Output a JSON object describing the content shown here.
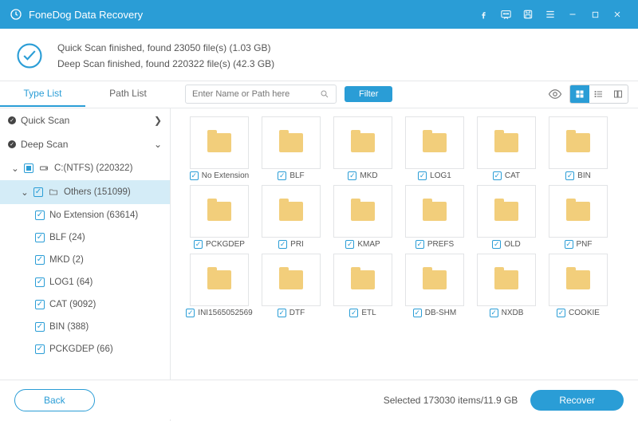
{
  "titlebar": {
    "app_name": "FoneDog Data Recovery"
  },
  "summary": {
    "quick_line": "Quick Scan finished, found 23050 file(s) (1.03 GB)",
    "deep_line": "Deep Scan finished, found 220322 file(s) (42.3 GB)"
  },
  "tabs": {
    "type": "Type List",
    "path": "Path List"
  },
  "search": {
    "placeholder": "Enter Name or Path here"
  },
  "filter_label": "Filter",
  "sidebar": {
    "quick_scan": "Quick Scan",
    "deep_scan": "Deep Scan",
    "drive": "C:(NTFS) (220322)",
    "others": "Others (151099)",
    "items": [
      {
        "label": "No Extension (63614)"
      },
      {
        "label": "BLF (24)"
      },
      {
        "label": "MKD (2)"
      },
      {
        "label": "LOG1 (64)"
      },
      {
        "label": "CAT (9092)"
      },
      {
        "label": "BIN (388)"
      },
      {
        "label": "PCKGDEP (66)"
      }
    ]
  },
  "grid": [
    [
      {
        "label": "No Extension"
      },
      {
        "label": "BLF"
      },
      {
        "label": "MKD"
      },
      {
        "label": "LOG1"
      },
      {
        "label": "CAT"
      },
      {
        "label": "BIN"
      }
    ],
    [
      {
        "label": "PCKGDEP"
      },
      {
        "label": "PRI"
      },
      {
        "label": "KMAP"
      },
      {
        "label": "PREFS"
      },
      {
        "label": "OLD"
      },
      {
        "label": "PNF"
      }
    ],
    [
      {
        "label": "INI1565052569"
      },
      {
        "label": "DTF"
      },
      {
        "label": "ETL"
      },
      {
        "label": "DB-SHM"
      },
      {
        "label": "NXDB"
      },
      {
        "label": "COOKIE"
      }
    ]
  ],
  "footer": {
    "back": "Back",
    "selected": "Selected 173030 items/11.9 GB",
    "recover": "Recover"
  }
}
